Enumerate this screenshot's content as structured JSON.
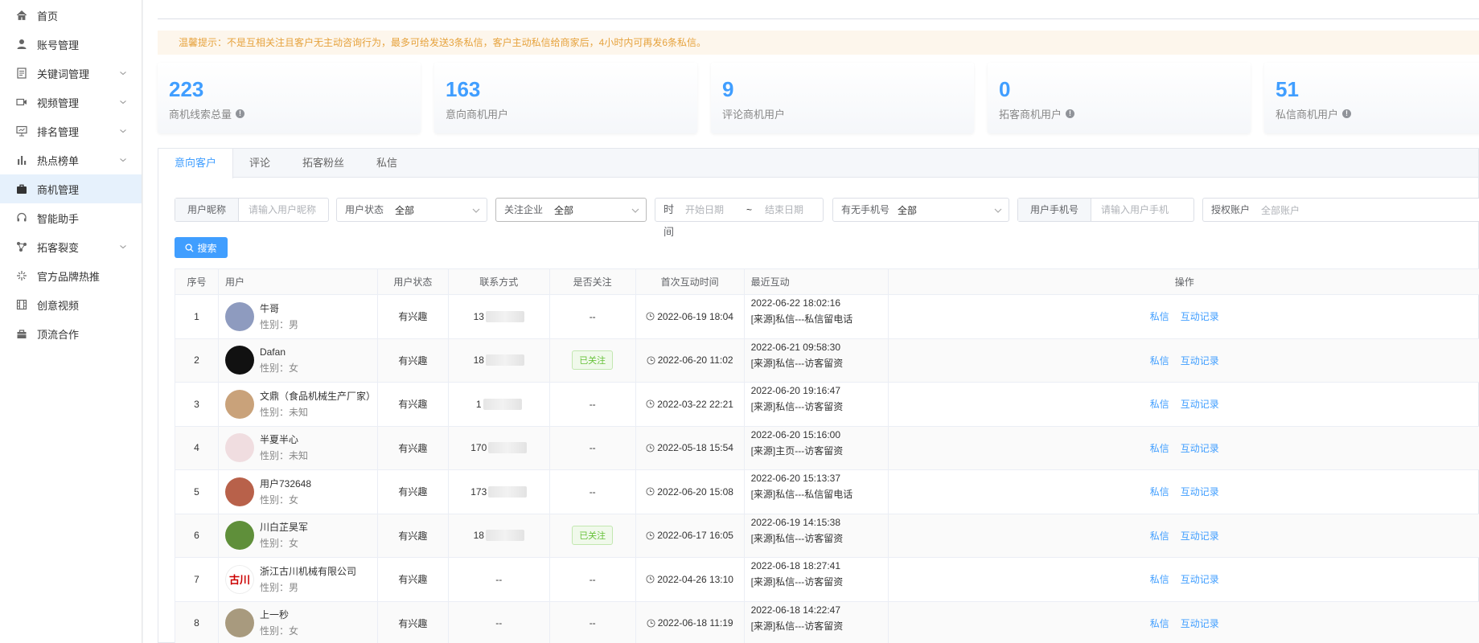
{
  "sidebar": {
    "items": [
      {
        "label": "首页",
        "icon": "home-icon",
        "has_children": false
      },
      {
        "label": "账号管理",
        "icon": "user-icon",
        "has_children": false
      },
      {
        "label": "关键词管理",
        "icon": "document-icon",
        "has_children": true
      },
      {
        "label": "视频管理",
        "icon": "video-icon",
        "has_children": true
      },
      {
        "label": "排名管理",
        "icon": "presentation-icon",
        "has_children": true
      },
      {
        "label": "热点榜单",
        "icon": "bar-chart-icon",
        "has_children": true
      },
      {
        "label": "商机管理",
        "icon": "briefcase-icon",
        "has_children": false,
        "active": true
      },
      {
        "label": "智能助手",
        "icon": "headset-icon",
        "has_children": false
      },
      {
        "label": "拓客裂变",
        "icon": "share-icon",
        "has_children": true
      },
      {
        "label": "官方品牌热推",
        "icon": "sparkle-icon",
        "has_children": false
      },
      {
        "label": "创意视频",
        "icon": "film-icon",
        "has_children": false
      },
      {
        "label": "顶流合作",
        "icon": "bag-icon",
        "has_children": false
      }
    ]
  },
  "tip": "温馨提示：不是互相关注且客户无主动咨询行为，最多可给发送3条私信，客户主动私信给商家后，4小时内可再发6条私信。",
  "stats": [
    {
      "value": "223",
      "label": "商机线索总量",
      "info": true
    },
    {
      "value": "163",
      "label": "意向商机用户",
      "info": false
    },
    {
      "value": "9",
      "label": "评论商机用户",
      "info": false
    },
    {
      "value": "0",
      "label": "拓客商机用户",
      "info": true
    },
    {
      "value": "51",
      "label": "私信商机用户",
      "info": true
    }
  ],
  "tabs": [
    "意向客户",
    "评论",
    "拓客粉丝",
    "私信"
  ],
  "filters": {
    "nickname_label": "用户昵称",
    "nickname_placeholder": "请输入用户昵称",
    "status_label": "用户状态",
    "status_value": "全部",
    "company_label": "关注企业",
    "company_value": "全部",
    "time_label": "时间",
    "start_placeholder": "开始日期",
    "range_sep": "~",
    "end_placeholder": "结束日期",
    "phone_has_label": "有无手机号",
    "phone_has_value": "全部",
    "phone_label": "用户手机号",
    "phone_placeholder": "请输入用户手机",
    "account_label": "授权账户",
    "account_placeholder": "全部账户"
  },
  "search_label": "搜索",
  "table": {
    "headers": [
      "序号",
      "用户",
      "用户状态",
      "联系方式",
      "是否关注",
      "首次互动时间",
      "最近互动",
      "操作"
    ],
    "gender_prefix": "性别：",
    "ops": [
      "私信",
      "互动记录"
    ],
    "rows": [
      {
        "no": "1",
        "name": "牛哥",
        "gender": "男",
        "status": "有兴趣",
        "phone": "13",
        "followed": "--",
        "first": "2022-06-19 18:04",
        "recent_time": "2022-06-22 18:02:16",
        "recent_src": "[来源]私信---私信留电话",
        "avatar_color": "#8e9bbf"
      },
      {
        "no": "2",
        "name": "Dafan",
        "gender": "女",
        "status": "有兴趣",
        "phone": "18",
        "followed": "已关注",
        "first": "2022-06-20 11:02",
        "recent_time": "2022-06-21 09:58:30",
        "recent_src": "[来源]私信---访客留资",
        "avatar_color": "#111111"
      },
      {
        "no": "3",
        "name": "文鼎（食品机械生产厂家）",
        "gender": "未知",
        "status": "有兴趣",
        "phone": "1",
        "followed": "--",
        "first": "2022-03-22 22:21",
        "recent_time": "2022-06-20 19:16:47",
        "recent_src": "[来源]私信---访客留资",
        "avatar_color": "#c9a27a"
      },
      {
        "no": "4",
        "name": "半夏半心",
        "gender": "未知",
        "status": "有兴趣",
        "phone": "170",
        "followed": "--",
        "first": "2022-05-18 15:54",
        "recent_time": "2022-06-20 15:16:00",
        "recent_src": "[来源]主页---访客留资",
        "avatar_color": "#f0dde0"
      },
      {
        "no": "5",
        "name": "用户732648",
        "gender": "女",
        "status": "有兴趣",
        "phone": "173",
        "followed": "--",
        "first": "2022-06-20 15:08",
        "recent_time": "2022-06-20 15:13:37",
        "recent_src": "[来源]私信---私信留电话",
        "avatar_color": "#b8614a"
      },
      {
        "no": "6",
        "name": "川白芷昊军",
        "gender": "女",
        "status": "有兴趣",
        "phone": "18",
        "followed": "已关注",
        "first": "2022-06-17 16:05",
        "recent_time": "2022-06-19 14:15:38",
        "recent_src": "[来源]私信---访客留资",
        "avatar_color": "#5f8f3a"
      },
      {
        "no": "7",
        "name": "浙江古川机械有限公司",
        "gender": "男",
        "status": "有兴趣",
        "phone": "--",
        "followed": "--",
        "first": "2022-04-26 13:10",
        "recent_time": "2022-06-18 18:27:41",
        "recent_src": "[来源]私信---访客留资",
        "avatar_color": "#ffffff",
        "avatar_text": "古川"
      },
      {
        "no": "8",
        "name": "上一秒",
        "gender": "女",
        "status": "有兴趣",
        "phone": "--",
        "followed": "--",
        "first": "2022-06-18 11:19",
        "recent_time": "2022-06-18 14:22:47",
        "recent_src": "[来源]私信---访客留资",
        "avatar_color": "#a89a7e"
      }
    ]
  },
  "colors": {
    "primary": "#409eff",
    "tip_text": "#e6a23c",
    "tip_bg": "#fdf6ec",
    "followed": "#67c23a"
  }
}
